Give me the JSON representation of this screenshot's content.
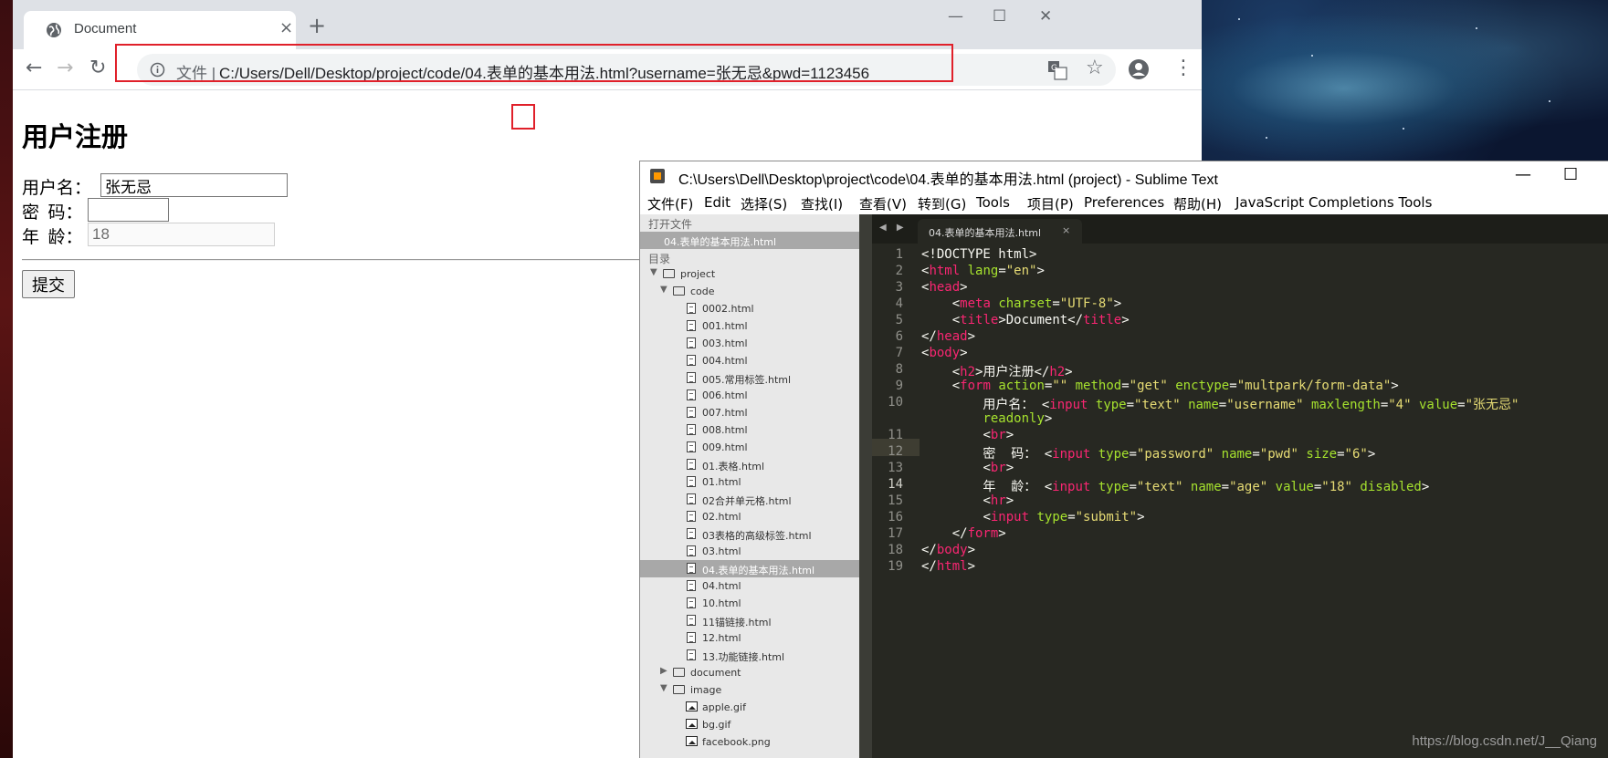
{
  "browser": {
    "tab_title": "Document",
    "close_glyph": "×",
    "new_tab_glyph": "+",
    "window_controls": [
      "—",
      "☐",
      "✕"
    ],
    "url_scheme": "文件 |",
    "url": "C:/Users/Dell/Desktop/project/code/04.表单的基本用法.html?username=张无忌&pwd=1123456",
    "back_glyph": "←",
    "forward_glyph": "→",
    "reload_glyph": "↻",
    "star_glyph": "☆",
    "menu_glyph": "⋮"
  },
  "page": {
    "title": "用户注册",
    "username_label": "用户名：",
    "username_value": "张无忌",
    "password_label": "密  码：",
    "password_value": "",
    "age_label": "年  龄：",
    "age_value": "18",
    "submit_label": "提交"
  },
  "sublime": {
    "title": "C:\\Users\\Dell\\Desktop\\project\\code\\04.表单的基本用法.html (project) - Sublime Text",
    "window_controls": [
      "—",
      "☐"
    ],
    "menu": [
      "文件(F)",
      "Edit",
      "选择(S)",
      "查找(I)",
      "查看(V)",
      "转到(G)",
      "Tools",
      "项目(P)",
      "Preferences",
      "帮助(H)",
      "JavaScript Completions Tools"
    ],
    "sidebar": {
      "open_files_header": "打开文件",
      "open_file": "04.表单的基本用法.html",
      "folders_header": "目录",
      "project": "project",
      "code_folder": "code",
      "files": [
        "0002.html",
        "001.html",
        "003.html",
        "004.html",
        "005.常用标签.html",
        "006.html",
        "007.html",
        "008.html",
        "009.html",
        "01.表格.html",
        "01.html",
        "02合并单元格.html",
        "02.html",
        "03表格的高级标签.html",
        "03.html",
        "04.表单的基本用法.html",
        "04.html",
        "10.html",
        "11锚链接.html",
        "12.html",
        "13.功能链接.html"
      ],
      "document_folder": "document",
      "image_folder": "image",
      "images": [
        "apple.gif",
        "bg.gif",
        "facebook.png"
      ]
    },
    "tab_nav": "◀ ▶",
    "editor_tab": "04.表单的基本用法.html",
    "editor_tab_close": "×",
    "line_numbers": [
      "1",
      "2",
      "3",
      "4",
      "5",
      "6",
      "7",
      "8",
      "9",
      "10",
      "",
      "11",
      "12",
      "13",
      "14",
      "15",
      "16",
      "17",
      "18",
      "19"
    ]
  },
  "watermark": "https://blog.csdn.net/J__Qiang"
}
